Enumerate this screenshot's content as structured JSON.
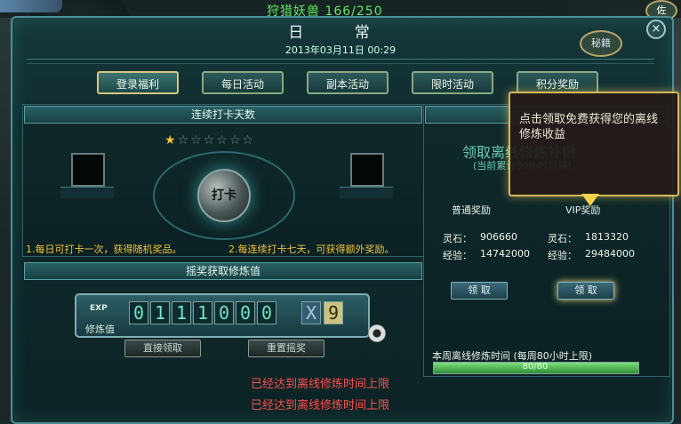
{
  "hud": {
    "hunt_text": "狩猎妖兽 166/250",
    "right_top": "佐",
    "mid_right_text": "秘籍"
  },
  "window": {
    "title": "日 常",
    "datetime": "2013年03月11日   00:29",
    "close_glyph": "×"
  },
  "tabs": [
    {
      "label": "登录福利",
      "active": true
    },
    {
      "label": "每日活动",
      "active": false
    },
    {
      "label": "副本活动",
      "active": false
    },
    {
      "label": "限时活动",
      "active": false
    },
    {
      "label": "积分奖励",
      "active": false
    }
  ],
  "checkin": {
    "header": "连续打卡天数",
    "stars_total": 7,
    "stars_filled": 1,
    "punch_button": "打卡",
    "rule1": "1.每日可打卡一次，获得随机奖品。",
    "rule2": "2.每连续打卡七天，可获得额外奖励。"
  },
  "lottery": {
    "header": "摇奖获取修炼值",
    "exp_label": "EXP",
    "cultivate_label": "修炼值",
    "digits": [
      "0",
      "1",
      "1",
      "1",
      "0",
      "0",
      "0"
    ],
    "mult_sign": "X",
    "multiplier": "9",
    "claim_button": "直接领取",
    "reset_button": "重置摇奖"
  },
  "messages": [
    "已经达到离线修炼时间上限",
    "已经达到离线修炼时间上限"
  ],
  "offline": {
    "title": "领取离线修炼补偿",
    "subtitle": "(当前累计30小时可领)",
    "normal": {
      "title": "普通奖励",
      "stone_label": "灵石：",
      "stone": "906660",
      "exp_label": "经验：",
      "exp": "14742000",
      "button": "领 取"
    },
    "vip": {
      "title": "VIP奖励",
      "stone_label": "灵石：",
      "stone": "1813320",
      "exp_label": "经验：",
      "exp": "29484000",
      "button": "领 取"
    },
    "weekly_label": "本周离线修炼时间 (每周80小时上限)",
    "progress_text": "80/80",
    "progress_fraction": 1.0
  },
  "tooltip": {
    "text": "点击领取免费获得您的离线修炼收益"
  }
}
